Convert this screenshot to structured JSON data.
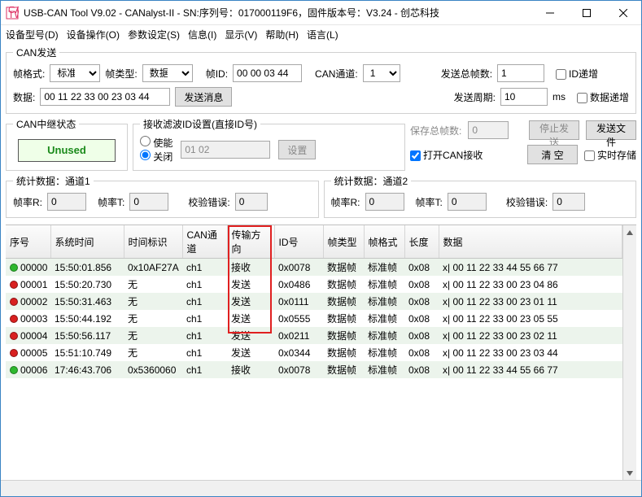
{
  "window": {
    "title": "USB-CAN Tool V9.02 - CANalyst-II - SN:序列号：017000119F6，固件版本号：V3.24 - 创芯科技"
  },
  "menu": {
    "device_model": "设备型号(D)",
    "device_op": "设备操作(O)",
    "param_set": "参数设定(S)",
    "info": "信息(I)",
    "display": "显示(V)",
    "help": "帮助(H)",
    "language": "语言(L)"
  },
  "can_send": {
    "legend": "CAN发送",
    "frame_format_label": "帧格式:",
    "frame_format_value": "标准帧",
    "frame_type_label": "帧类型:",
    "frame_type_value": "数据帧",
    "frame_id_label": "帧ID:",
    "frame_id_value": "00 00 03 44",
    "can_channel_label": "CAN通道:",
    "can_channel_value": "1",
    "total_frames_label": "发送总帧数:",
    "total_frames_value": "1",
    "id_inc_label": "ID递增",
    "data_label": "数据:",
    "data_value": "00 11 22 33 00 23 03 44",
    "send_msg_btn": "发送消息",
    "send_period_label": "发送周期:",
    "send_period_value": "10",
    "send_period_unit": "ms",
    "data_inc_label": "数据递增"
  },
  "relay": {
    "legend": "CAN中继状态",
    "unused": "Unused"
  },
  "filter": {
    "legend": "接收滤波ID设置(直接ID号)",
    "enable": "使能",
    "disable": "关闭",
    "ids_value": "01 02",
    "set_btn": "设置"
  },
  "right": {
    "save_frames_label": "保存总帧数:",
    "save_frames_value": "0",
    "stop_send_btn": "停止发送",
    "send_file_btn": "发送文件",
    "open_can_recv": "打开CAN接收",
    "clear_btn": "清 空",
    "realtime_save": "实时存储"
  },
  "stats1": {
    "legend": "统计数据：通道1",
    "rate_r_label": "帧率R:",
    "rate_r_value": "0",
    "rate_t_label": "帧率T:",
    "rate_t_value": "0",
    "err_label": "校验错误:",
    "err_value": "0"
  },
  "stats2": {
    "legend": "统计数据：通道2",
    "rate_r_label": "帧率R:",
    "rate_r_value": "0",
    "rate_t_label": "帧率T:",
    "rate_t_value": "0",
    "err_label": "校验错误:",
    "err_value": "0"
  },
  "grid": {
    "headers": {
      "seq": "序号",
      "systime": "系统时间",
      "timemark": "时间标识",
      "channel": "CAN通道",
      "dir": "传输方向",
      "id": "ID号",
      "ftype": "帧类型",
      "fformat": "帧格式",
      "len": "长度",
      "data": "数据"
    },
    "rows": [
      {
        "dot": "g",
        "seq": "00000",
        "systime": "15:50:01.856",
        "timemark": "0x10AF27A",
        "channel": "ch1",
        "dir": "接收",
        "id": "0x0078",
        "ftype": "数据帧",
        "fformat": "标准帧",
        "len": "0x08",
        "data": "x| 00 11 22 33 44 55 66 77"
      },
      {
        "dot": "r",
        "seq": "00001",
        "systime": "15:50:20.730",
        "timemark": "无",
        "channel": "ch1",
        "dir": "发送",
        "id": "0x0486",
        "ftype": "数据帧",
        "fformat": "标准帧",
        "len": "0x08",
        "data": "x| 00 11 22 33 00 23 04 86"
      },
      {
        "dot": "r",
        "seq": "00002",
        "systime": "15:50:31.463",
        "timemark": "无",
        "channel": "ch1",
        "dir": "发送",
        "id": "0x0111",
        "ftype": "数据帧",
        "fformat": "标准帧",
        "len": "0x08",
        "data": "x| 00 11 22 33 00 23 01 11"
      },
      {
        "dot": "r",
        "seq": "00003",
        "systime": "15:50:44.192",
        "timemark": "无",
        "channel": "ch1",
        "dir": "发送",
        "id": "0x0555",
        "ftype": "数据帧",
        "fformat": "标准帧",
        "len": "0x08",
        "data": "x| 00 11 22 33 00 23 05 55"
      },
      {
        "dot": "r",
        "seq": "00004",
        "systime": "15:50:56.117",
        "timemark": "无",
        "channel": "ch1",
        "dir": "发送",
        "id": "0x0211",
        "ftype": "数据帧",
        "fformat": "标准帧",
        "len": "0x08",
        "data": "x| 00 11 22 33 00 23 02 11"
      },
      {
        "dot": "r",
        "seq": "00005",
        "systime": "15:51:10.749",
        "timemark": "无",
        "channel": "ch1",
        "dir": "发送",
        "id": "0x0344",
        "ftype": "数据帧",
        "fformat": "标准帧",
        "len": "0x08",
        "data": "x| 00 11 22 33 00 23 03 44"
      },
      {
        "dot": "g",
        "seq": "00006",
        "systime": "17:46:43.706",
        "timemark": "0x5360060",
        "channel": "ch1",
        "dir": "接收",
        "id": "0x0078",
        "ftype": "数据帧",
        "fformat": "标准帧",
        "len": "0x08",
        "data": "x| 00 11 22 33 44 55 66 77"
      }
    ]
  }
}
